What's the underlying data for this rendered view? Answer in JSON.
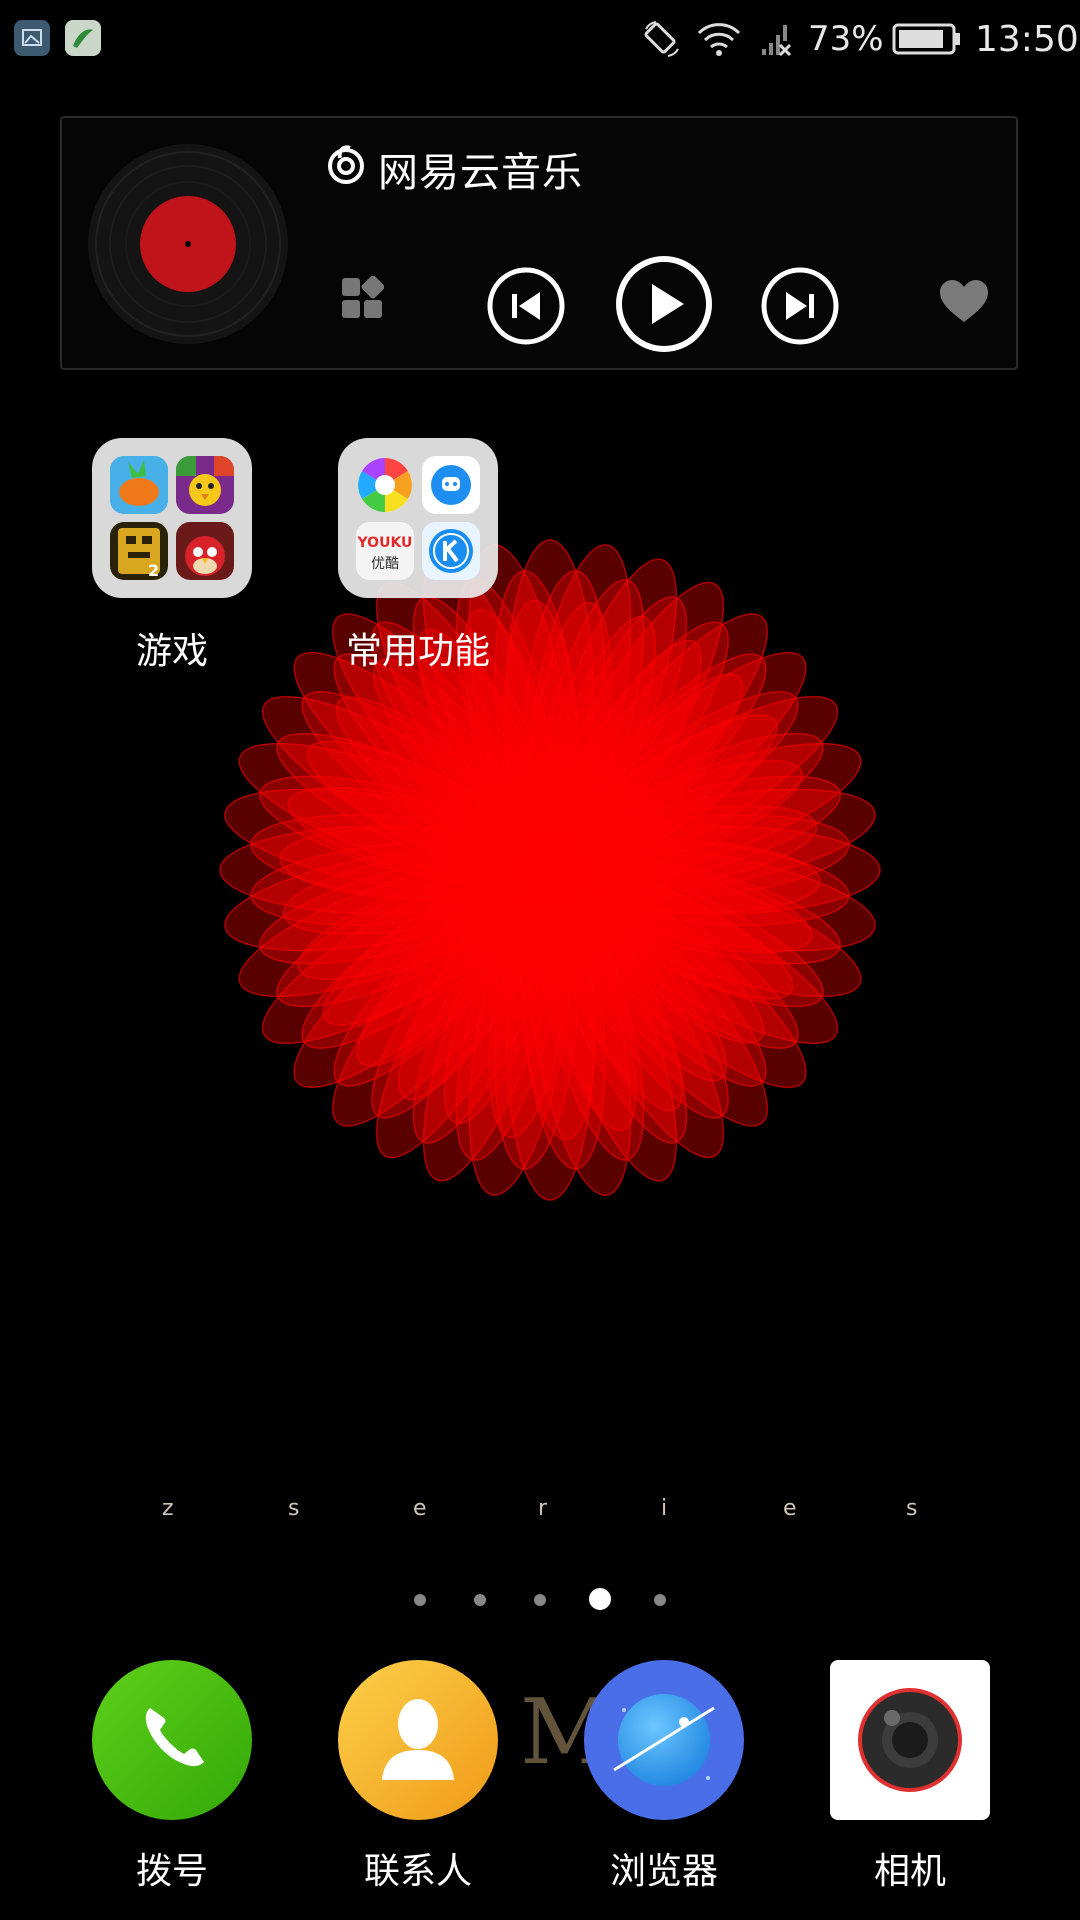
{
  "status_bar": {
    "battery_percent": "73%",
    "time": "13:50",
    "icons": [
      "gallery-notification-icon",
      "app-notification-icon",
      "rotate-lock-icon",
      "wifi-icon",
      "signal-no-sim-icon",
      "battery-icon"
    ]
  },
  "music_widget": {
    "app_name": "网易云音乐",
    "controls": [
      "grid-icon",
      "previous-icon",
      "play-icon",
      "next-icon",
      "heart-icon"
    ]
  },
  "folders": [
    {
      "label": "游戏"
    },
    {
      "label": "常用功能",
      "youku_text": "YOUKU",
      "youku_cn": "优酷"
    }
  ],
  "zseries": [
    "z",
    "s",
    "e",
    "r",
    "i",
    "e",
    "s"
  ],
  "page_indicator": {
    "pages": 5,
    "current": 4
  },
  "watermark": "M",
  "dock": [
    {
      "label": "拨号"
    },
    {
      "label": "联系人"
    },
    {
      "label": "浏览器"
    },
    {
      "label": "相机"
    }
  ],
  "colors": {
    "flower": "#ff0000",
    "phone": "#48c010",
    "contacts": "#f5b62a",
    "browser": "#4a6ee8",
    "camera_ring": "#e03030"
  }
}
